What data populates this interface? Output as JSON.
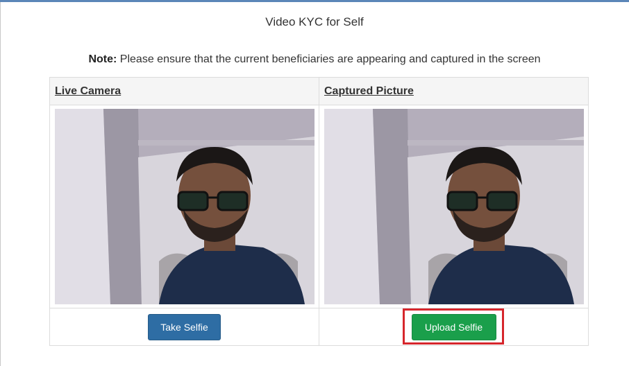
{
  "page": {
    "title": "Video KYC for Self",
    "note_label": "Note:",
    "note_text": " Please ensure that the current beneficiaries are appearing and captured in the screen"
  },
  "table": {
    "headers": [
      "Live Camera",
      "Captured Picture"
    ]
  },
  "actions": {
    "take_selfie_label": "Take Selfie",
    "upload_selfie_label": "Upload Selfie"
  },
  "colors": {
    "take_selfie_bg": "#2e6da4",
    "upload_selfie_bg": "#1a9f4b",
    "highlight_border": "#d6262c"
  }
}
